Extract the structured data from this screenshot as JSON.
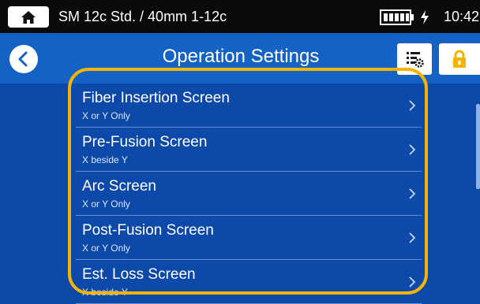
{
  "statusbar": {
    "title": "SM 12c Std. / 40mm 1-12c",
    "time": "10:42",
    "home_icon": "home-icon",
    "battery_icon": "battery-icon",
    "charging_icon": "lightning-icon"
  },
  "header": {
    "title": "Operation Settings",
    "back_icon": "chevron-left-icon",
    "settings_icon": "list-gear-icon",
    "lock_icon": "lock-icon"
  },
  "items": [
    {
      "label": "Fiber Insertion Screen",
      "sub": "X or Y Only"
    },
    {
      "label": "Pre-Fusion Screen",
      "sub": "X beside Y"
    },
    {
      "label": "Arc Screen",
      "sub": "X or Y Only"
    },
    {
      "label": "Post-Fusion Screen",
      "sub": "X or Y Only"
    },
    {
      "label": "Est. Loss Screen",
      "sub": "X beside Y"
    }
  ],
  "colors": {
    "background": "#0d49a8",
    "header": "#1463c4",
    "highlight": "#f5b400",
    "accent": "#1463c4"
  }
}
